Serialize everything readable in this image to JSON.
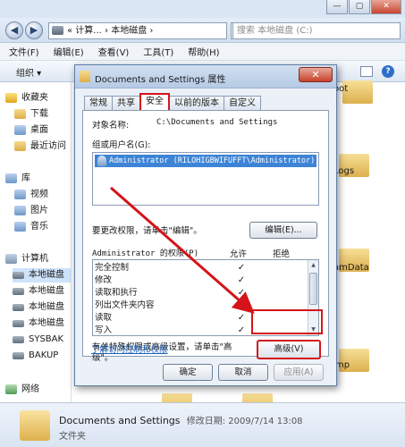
{
  "explorer": {
    "address_text": "« 计算... › 本地磁盘 ›",
    "search_placeholder": "搜索 本地磁盘 (C:)",
    "menu": [
      "文件(F)",
      "编辑(E)",
      "查看(V)",
      "工具(T)",
      "帮助(H)"
    ],
    "organize_label": "组织 ▾",
    "nav": {
      "favorites": "收藏夹",
      "downloads": "下载",
      "desktop": "桌面",
      "recent": "最近访问",
      "libraries": "库",
      "videos": "视频",
      "pictures": "图片",
      "music": "音乐",
      "computer": "计算机",
      "drives": [
        "本地磁盘",
        "本地磁盘",
        "本地磁盘",
        "本地磁盘",
        "SYSBAK",
        "BAKUP"
      ],
      "network": "网络"
    },
    "side_fragments": [
      "oot",
      "Logs",
      "amData",
      "mp"
    ],
    "details": {
      "name": "Documents and Settings",
      "modified": "修改日期: 2009/7/14 13:08",
      "type": "文件夹"
    }
  },
  "dialog": {
    "title": "Documents and Settings 属性",
    "close_label": "✕",
    "tabs": [
      "常规",
      "共享",
      "安全",
      "以前的版本",
      "自定义"
    ],
    "active_tab": "安全",
    "object_label": "对象名称:",
    "object_value": "C:\\Documents and Settings",
    "group_label": "组或用户名(G):",
    "users": [
      "Administrator (RILOHIGBWIFUFFT\\Administrator)"
    ],
    "change_perm_text": "要更改权限，请单击\"编辑\"。",
    "edit_button": "编辑(E)...",
    "perm_header": "Administrator 的权限(P)",
    "allow_header": "允许",
    "deny_header": "拒绝",
    "permissions": [
      {
        "name": "完全控制",
        "allow": "✓"
      },
      {
        "name": "修改",
        "allow": "✓"
      },
      {
        "name": "读取和执行",
        "allow": "✓"
      },
      {
        "name": "列出文件夹内容",
        "allow": "✓"
      },
      {
        "name": "读取",
        "allow": "✓"
      },
      {
        "name": "写入",
        "allow": "✓"
      }
    ],
    "advanced_text_1": "有关特殊权限或高级设置，请单击\"高",
    "advanced_text_2": "级\"。",
    "advanced_button": "高级(V)",
    "learn_link": "了解访问控制和权限",
    "ok_button": "确定",
    "cancel_button": "取消",
    "apply_button": "应用(A)"
  },
  "colors": {
    "highlight": "#d4141a",
    "selection": "#3d84d6",
    "link": "#1b5fb8"
  }
}
